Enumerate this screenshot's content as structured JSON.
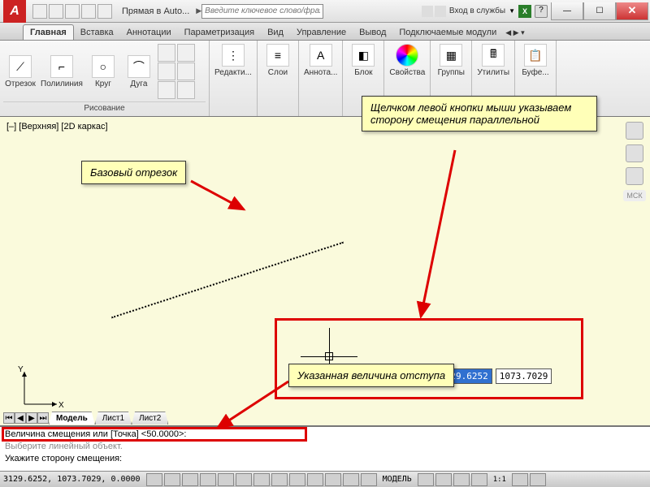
{
  "title": "Прямая в Auto...",
  "search_placeholder": "Введите ключевое слово/фразу",
  "signin": "Вход в службы",
  "tabs": [
    "Главная",
    "Вставка",
    "Аннотации",
    "Параметризация",
    "Вид",
    "Управление",
    "Вывод",
    "Подключаемые модули"
  ],
  "drawing_panel": "Рисование",
  "tools": {
    "line": "Отрезок",
    "polyline": "Полилиния",
    "circle": "Круг",
    "arc": "Дуга",
    "edit": "Редакти...",
    "layers": "Слои",
    "annot": "Аннота...",
    "block": "Блок",
    "props": "Свойства",
    "groups": "Группы",
    "util": "Утилиты",
    "buf": "Буфе..."
  },
  "view_label": "[–] [Верхняя] [2D каркас]",
  "callout_base": "Базовый отрезок",
  "callout_side": "Щелчком левой кнопки мыши указываем сторону смещения параллельной",
  "callout_offset": "Указанная величина отступа",
  "dyn_prompt": "Укажите сторону смещения:",
  "dyn_x": "3129.6252",
  "dyn_y": "1073.7029",
  "layout_tabs": {
    "model": "Модель",
    "sheet1": "Лист1",
    "sheet2": "Лист2"
  },
  "cmd1": "Величина смещения или [Точка] <50.0000>:",
  "cmd2": "Выберите линейный объект.",
  "cmd3": "Укажите сторону смещения:",
  "status_coords": "3129.6252, 1073.7029, 0.0000",
  "status_model": "МОДЕЛЬ",
  "status_scale": "1:1",
  "right_label": "МСК"
}
